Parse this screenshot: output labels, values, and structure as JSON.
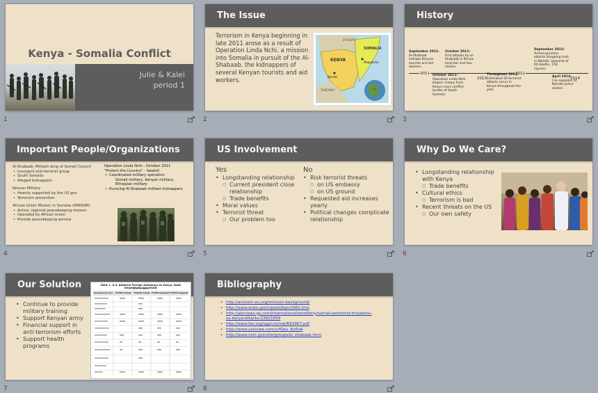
{
  "slides": [
    {
      "number": "1",
      "title": "Kenya - Somalia Conflict",
      "authors": "Julie & Kalei",
      "period": "period 1",
      "image_icon": "soldiers-photo"
    },
    {
      "number": "2",
      "title": "The Issue",
      "body": "Terrorism in Kenya beginning in late 2011 arose as a result of Operation Linda Nchi, a mission into Somalia in pursuit of the Al-Shabaab, the kidnappers of several Kenyan tourists and aid workers.",
      "map_labels": {
        "kenya": "KENYA",
        "somalia": "SOMALIA",
        "ethiopia": "ETHIOPIA",
        "mogadishu": "Mogadishu",
        "nairobi": "Nairobi",
        "tanzania": "TANZANIA"
      }
    },
    {
      "number": "3",
      "title": "History",
      "timeline": {
        "top": [
          {
            "head": "September 2011:",
            "text": "Al-Shabaab kidnaps Kenyan tourists and aid workers."
          },
          {
            "head": "October 2011:",
            "text": "First attacks by al-Shabaab in Kenya: local bar and bus station"
          },
          {
            "head": "September 2013:",
            "text": "Armed gunmen attacks shopping mall in Nairobi. Upwards of 60 deaths, 150 injuries."
          }
        ],
        "bottom": [
          {
            "head": "October 2011:",
            "text": "Operation Linda Nchi begins- troops from Kenya cross conflict border of South Somalia"
          },
          {
            "head": "Throughout 2012:",
            "text": "Estimated 30 terrorist attacks occur in Kenya throughout the year."
          },
          {
            "head": "April 2014:",
            "text": "Car explodes at Nairobi police station"
          }
        ],
        "years": {
          "y2011": "2011",
          "y2012": "2012",
          "y2013": "2013",
          "y2014": "2014"
        }
      }
    },
    {
      "number": "4",
      "title": "Important People/Organizations",
      "left": {
        "al_shabaab_head": "Al-Shabaab: Militant wing of Somali Council",
        "al_shabaab_items": [
          "Insurgent and terrorist group",
          "South Somalia",
          "Alleged kidnappers"
        ],
        "military_head": "Kenyan Military",
        "military_items": [
          "Heavily supported by the US gov",
          "Terrorism prevention"
        ],
        "amisom_head": "African Union Mission in Somalia (AMISOM)",
        "amisom_items": [
          "Active, regional peacekeeping mission",
          "Operated by African Union",
          "Provide peacekeeping service"
        ]
      },
      "right": {
        "op_head": "Operation Linda Nchi - October 2011",
        "op_sub": "\"Protect the Country\" - Swahili",
        "items": [
          "Coordinated military operation",
          "Pursuing Al-Shabaab militant kidnappers"
        ],
        "sub_item": "Somali military, Kenyan military, Ethiopian military"
      }
    },
    {
      "number": "5",
      "title": "US Involvement",
      "yes": {
        "label": "Yes",
        "l1": "Longstanding relationship",
        "l1_subs": [
          "Current president close relationship",
          "Trade benefits"
        ],
        "l2": "Moral values",
        "l3": "Terrorist threat",
        "l3_sub": "Our problem too"
      },
      "no": {
        "label": "No",
        "l1": "Risk terrorist threats",
        "l1_subs": [
          "on US embassy",
          "on US ground"
        ],
        "l2": "Requested aid increases yearly",
        "l3": "Political changes complicate relationship"
      }
    },
    {
      "number": "6",
      "title": "Why Do We Care?",
      "l1": "Longstanding relationship with Kenya",
      "l1_sub": "Trade benefits",
      "l2": "Cultural ethics",
      "l2_sub": "Terrorism is bad",
      "l3": "Recent threats on the US",
      "l3_sub": "Our own safety"
    },
    {
      "number": "7",
      "title": "Our Solution",
      "items": [
        "Continue to provide military training",
        "Support Kenyan army",
        "Financial support in anti-terrorism efforts",
        "Support health programs"
      ],
      "table_title": "Table 1. U.S. Bilateral Foreign Assistance to Kenya, State Department and USAID",
      "table_subtitle": "($ in millions)",
      "table_headers": [
        "Accounts by Year",
        "FY2011 Actual",
        "FY2012 Actual",
        "FY2013 Request",
        "FY2014 Request"
      ]
    },
    {
      "number": "8",
      "title": "Bibliography",
      "links": [
        "http://amisom-au.org/amisom-background/",
        "http://www.state.gov/r/pa/ei/bgn/2962.htm",
        "http://abcnews.go.com/International/wireStory/somali-extremist-threatens-us-kenya-attacks-23821659",
        "http://www.fas.org/sgp/crs/row/R42967.pdf",
        "http://www.youtube.com/v/fQeu_lKz5sA",
        "http://www.nctc.gov/site/groups/al_shabaab.html"
      ]
    }
  ],
  "colors": {
    "slide_bg": "#efe1c8",
    "header_bg": "#5d5d5d",
    "desk_bg": "#a7adb6",
    "link": "#1a3ccc"
  }
}
